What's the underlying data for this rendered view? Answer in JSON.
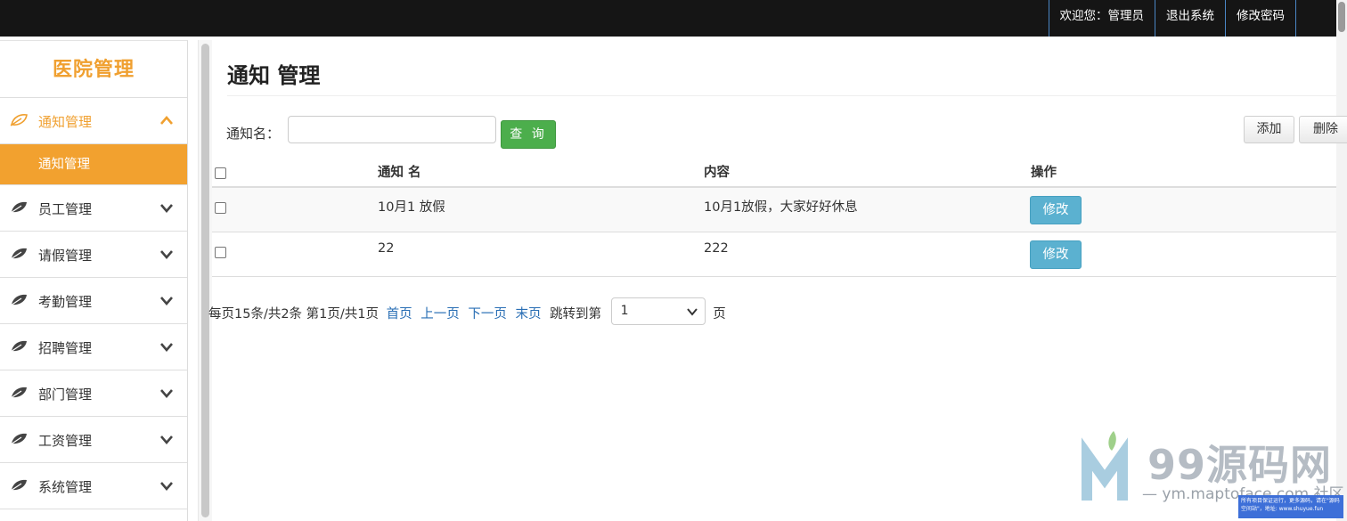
{
  "topbar": {
    "welcome": "欢迎您：管理员",
    "logout": "退出系统",
    "change_password": "修改密码"
  },
  "sidebar": {
    "brand": "医院管理",
    "items": [
      {
        "label": "通知管理",
        "icon": "leaf-icon",
        "expanded": true,
        "sub": [
          "通知管理"
        ]
      },
      {
        "label": "员工管理",
        "icon": "leaf-icon",
        "expanded": false
      },
      {
        "label": "请假管理",
        "icon": "leaf-icon",
        "expanded": false
      },
      {
        "label": "考勤管理",
        "icon": "leaf-icon",
        "expanded": false
      },
      {
        "label": "招聘管理",
        "icon": "leaf-icon",
        "expanded": false
      },
      {
        "label": "部门管理",
        "icon": "leaf-icon",
        "expanded": false
      },
      {
        "label": "工资管理",
        "icon": "leaf-icon",
        "expanded": false
      },
      {
        "label": "系统管理",
        "icon": "leaf-icon",
        "expanded": false
      }
    ]
  },
  "main": {
    "title": "通知 管理",
    "search": {
      "label": "通知名：",
      "value": "",
      "placeholder": "",
      "button": "查 询"
    },
    "actions": {
      "add": "添加",
      "delete": "删除"
    },
    "table": {
      "columns": [
        "通知 名",
        "内容",
        "操作"
      ],
      "rows": [
        {
          "name": "10月1 放假",
          "content": "10月1放假，大家好好休息",
          "action": "修改"
        },
        {
          "name": "22",
          "content": "222",
          "action": "修改"
        }
      ]
    },
    "pager": {
      "summary": "每页15条/共2条 第1页/共1页",
      "first": "首页",
      "prev": "上一页",
      "next": "下一页",
      "last": "末页",
      "jump_label": "跳转到第",
      "jump_value": "1",
      "page_suffix": "页"
    }
  },
  "watermark": {
    "brand": "99源码网",
    "url": "— ym.maptoface.com 社区",
    "notice": "所有项目保证运行，更多源码，请在\"源码空间站\"，地址: www.shuyue.fun"
  },
  "colors": {
    "topbar_bg": "#151515",
    "accent_orange": "#f2a12f",
    "search_green": "#4cae4c",
    "edit_blue": "#5bb1d0",
    "link_blue": "#2a6fb5"
  }
}
